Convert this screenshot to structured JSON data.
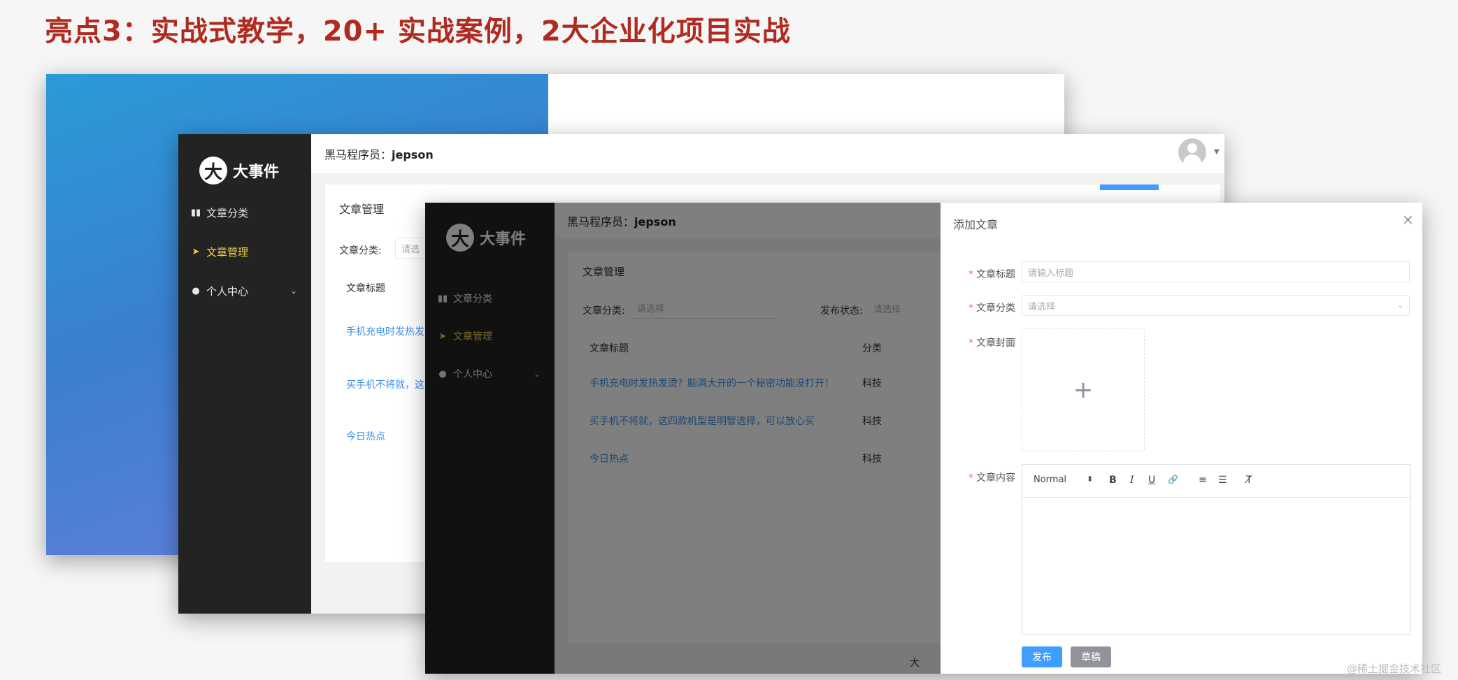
{
  "slide": {
    "title": "亮点3：实战式教学，20+ 实战案例，2大企业化项目实战"
  },
  "app": {
    "logo_glyph": "大",
    "logo_text": "大事件",
    "user_prefix": "黑马程序员：",
    "user_name": "jepson",
    "menu": [
      {
        "icon": "▮▮",
        "label": "文章分类"
      },
      {
        "icon": "➤",
        "label": "文章管理"
      },
      {
        "icon": "●",
        "label": "个人中心",
        "chevron": "⌄"
      }
    ]
  },
  "middle_window": {
    "card_title": "文章管理",
    "filter_label": "文章分类:",
    "filter_placeholder": "请选",
    "col_title": "文章标题",
    "rows": [
      "手机充电时发热发",
      "买手机不将就，这",
      "今日热点"
    ]
  },
  "front_window": {
    "card_title": "文章管理",
    "filter_category_label": "文章分类:",
    "filter_category_placeholder": "请选择",
    "filter_status_label": "发布状态:",
    "filter_status_placeholder": "请选择",
    "col_title": "文章标题",
    "col_category": "分类",
    "rows": [
      {
        "title": "手机充电时发热发烫？脑洞大开的一个秘密功能没打开！",
        "category": "科技"
      },
      {
        "title": "买手机不将就，这四款机型是明智选择，可以放心买",
        "category": "科技"
      },
      {
        "title": "今日热点",
        "category": "科技"
      }
    ],
    "footer_glyph": "大"
  },
  "drawer": {
    "title": "添加文章",
    "close": "×",
    "fields": {
      "title_label": "文章标题",
      "title_placeholder": "请输入标题",
      "category_label": "文章分类",
      "category_placeholder": "请选择",
      "cover_label": "文章封面",
      "upload_plus": "+",
      "content_label": "文章内容"
    },
    "editor_toolbar": {
      "format": "Normal",
      "format_arrows": "⬍",
      "bold": "B",
      "italic": "I",
      "underline": "U",
      "link": "🔗",
      "ordered_list": "≡",
      "bullet_list": "☰",
      "clear_format": "T̸"
    },
    "publish_btn": "发布",
    "draft_btn": "草稿"
  },
  "watermark": "@稀土掘金技术社区"
}
